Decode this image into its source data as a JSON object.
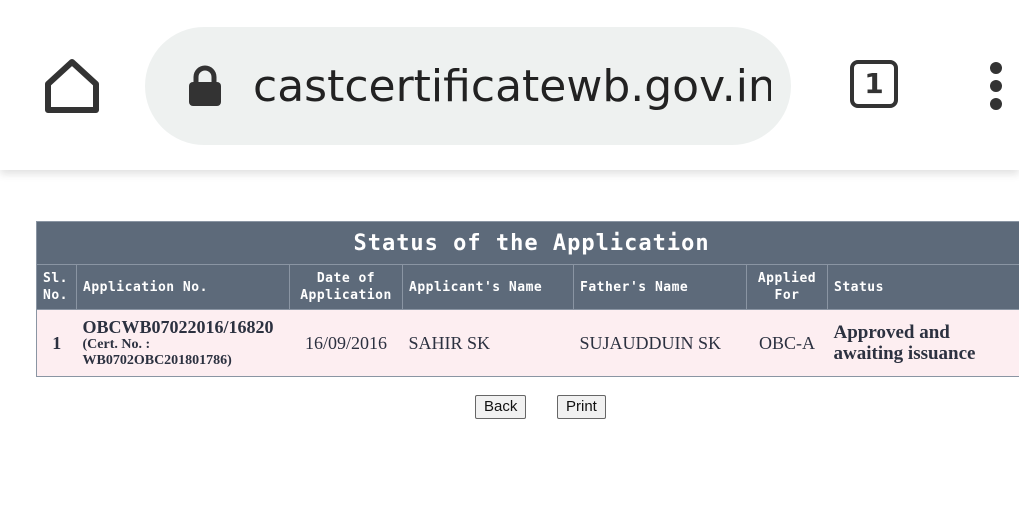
{
  "browser": {
    "url": "castcertificatewb.gov.in/",
    "tab_count": "1"
  },
  "status_table": {
    "title": "Status of the Application",
    "headers": {
      "sl_no": "Sl. No.",
      "app_no": "Application No.",
      "date": "Date of Application",
      "name": "Applicant's Name",
      "father": "Father's Name",
      "applied_for": "Applied For",
      "status": "Status"
    },
    "rows": [
      {
        "sl_no": "1",
        "app_no": "OBCWB07022016/16820",
        "cert_label": "(Cert. No. :",
        "cert_no": "WB0702OBC201801786)",
        "date": "16/09/2016",
        "name": "SAHIR SK",
        "father": "SUJAUDDUIN SK",
        "applied_for": "OBC-A",
        "status": "Approved and awaiting issuance"
      }
    ]
  },
  "buttons": {
    "back": "Back",
    "print": "Print"
  },
  "icons": {
    "home": "home-icon",
    "lock": "lock-icon",
    "tabs": "tab-switcher-icon",
    "menu": "more-vert-icon"
  },
  "colors": {
    "header_bg": "#5d6a7a",
    "row_bg": "#fdeef1",
    "url_bar_bg": "#eef1f0"
  }
}
